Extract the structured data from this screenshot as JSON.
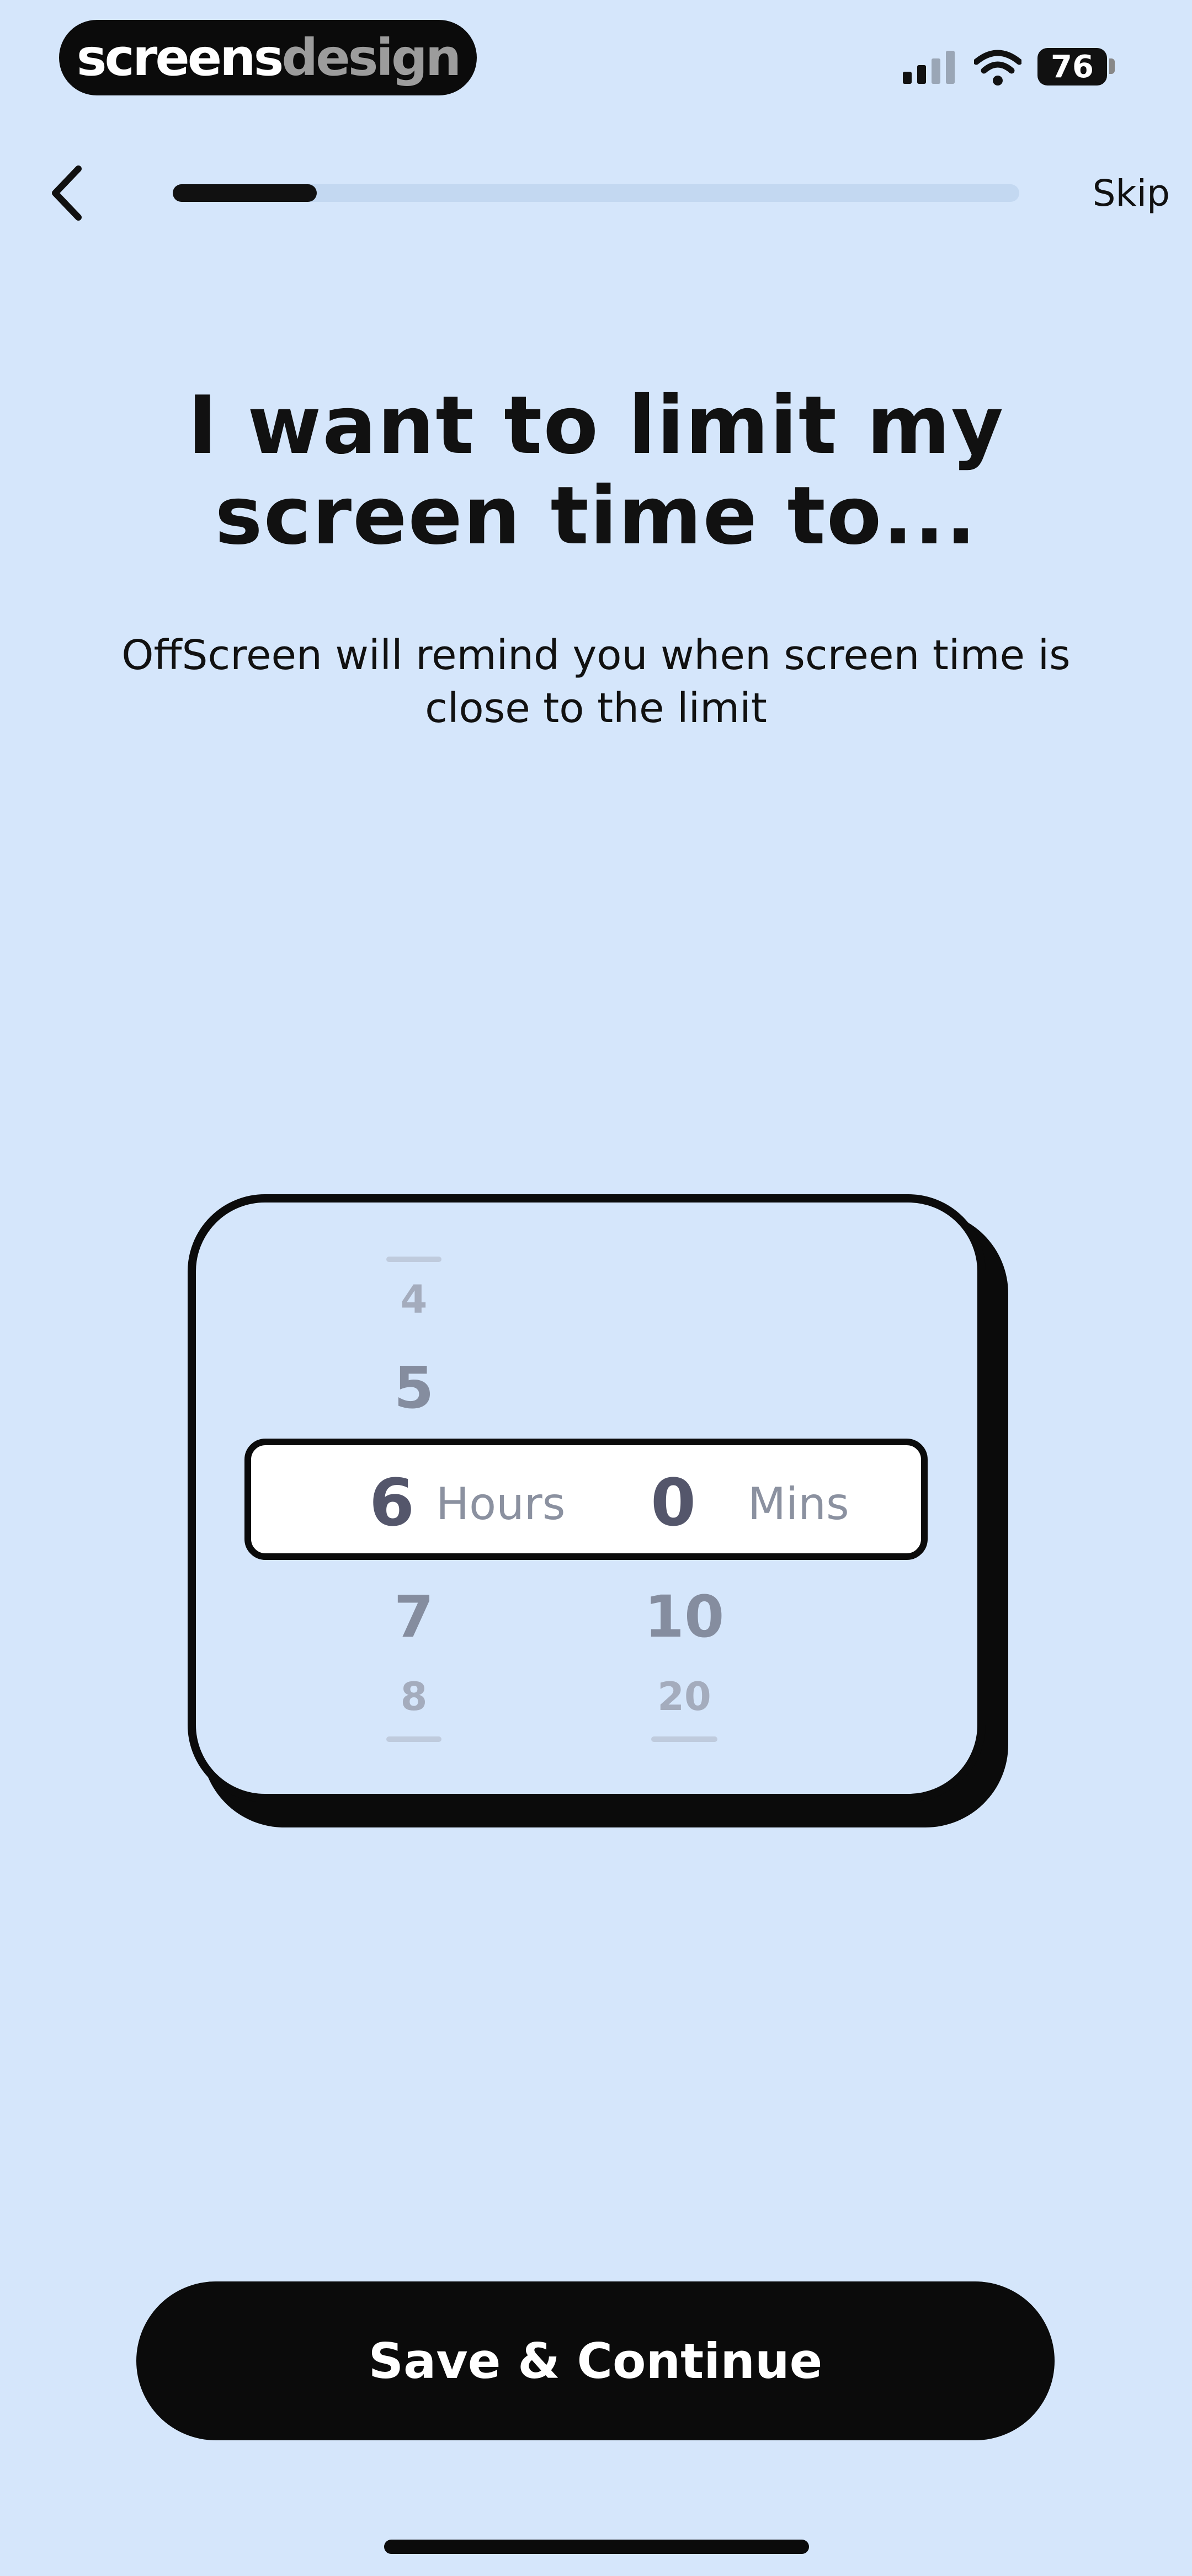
{
  "status_bar": {
    "brand_part1": "screens",
    "brand_part2": "design",
    "battery_level": "76"
  },
  "nav": {
    "skip_label": "Skip",
    "progress": 0.17
  },
  "header": {
    "title": "I want to limit my screen time to...",
    "subtitle": "OffScreen will remind you when screen time is close to the limit"
  },
  "picker": {
    "hours_above": [
      "4",
      "5"
    ],
    "selected_hours": "6",
    "hours_label": "Hours",
    "hours_below": [
      "7",
      "8"
    ],
    "selected_mins": "0",
    "mins_label": "Mins",
    "mins_below": [
      "10",
      "20"
    ]
  },
  "cta": {
    "label": "Save & Continue"
  }
}
